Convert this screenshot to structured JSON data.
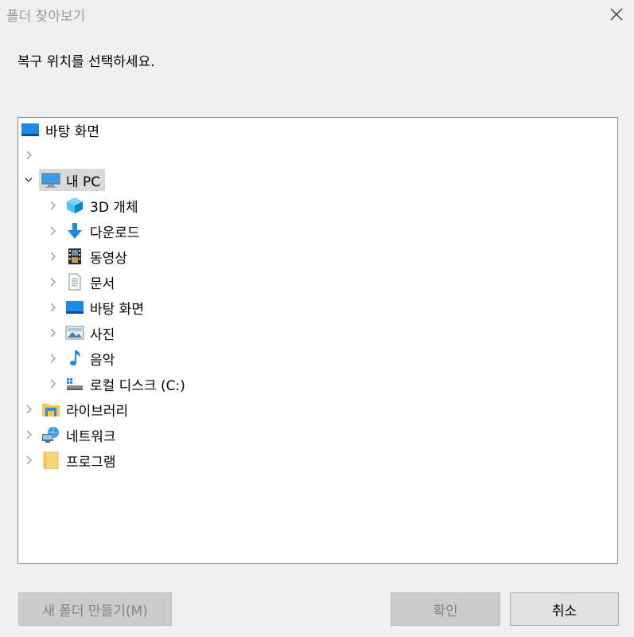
{
  "dialog": {
    "title": "폴더 찾아보기",
    "prompt": "복구 위치를 선택하세요."
  },
  "tree": {
    "desktop_root": "바탕 화면",
    "this_pc": "내 PC",
    "children": {
      "objects_3d": "3D 개체",
      "downloads": "다운로드",
      "videos": "동영상",
      "documents": "문서",
      "desktop": "바탕 화면",
      "pictures": "사진",
      "music": "음악",
      "local_disk": "로컬 디스크 (C:)"
    },
    "libraries": "라이브러리",
    "network": "네트워크",
    "programs": "프로그램"
  },
  "buttons": {
    "new_folder": "새 폴더 만들기(M)",
    "ok": "확인",
    "cancel": "취소"
  },
  "icons": {
    "close": "close-icon",
    "chevron_right": "chevron-right-icon",
    "chevron_down": "chevron-down-icon",
    "desktop": "desktop-icon",
    "pc": "computer-icon",
    "cube": "3d-objects-icon",
    "download": "download-arrow-icon",
    "video": "film-icon",
    "document": "document-icon",
    "pictures": "picture-icon",
    "music": "music-note-icon",
    "drive": "drive-icon",
    "library": "library-icon",
    "network": "network-icon",
    "folder": "folder-icon"
  },
  "colors": {
    "window_bg": "#f0f0f0",
    "selection_bg": "#d9d9d9",
    "accent_blue": "#1e88e5"
  }
}
